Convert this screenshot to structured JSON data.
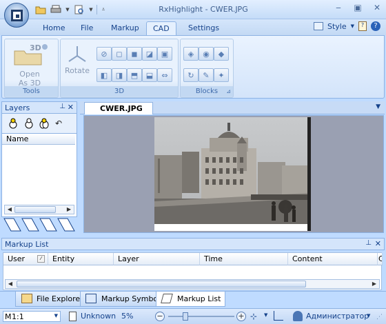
{
  "window": {
    "title": "RxHighlight - CWER.JPG",
    "controls": [
      "minimize-icon",
      "restore-icon",
      "close-icon"
    ]
  },
  "ribbon_tabs": [
    {
      "label": "Home",
      "active": false
    },
    {
      "label": "File",
      "active": false
    },
    {
      "label": "Markup",
      "active": false
    },
    {
      "label": "CAD",
      "active": true
    },
    {
      "label": "Settings",
      "active": false
    }
  ],
  "ribbon_right": {
    "style_label": "Style"
  },
  "ribbon_groups": {
    "tools": {
      "label": "Tools",
      "open_3d_label": "Open\nAs 3D",
      "open_3d_line1": "Open",
      "open_3d_line2": "As 3D"
    },
    "three_d": {
      "label": "3D",
      "rotate_label": "Rotate"
    },
    "blocks": {
      "label": "Blocks"
    }
  },
  "layers_panel": {
    "title": "Layers",
    "column": "Name"
  },
  "document": {
    "tab": "CWER.JPG"
  },
  "markup_list": {
    "title": "Markup List",
    "columns": [
      "User",
      "Entity",
      "Layer",
      "Time",
      "Content",
      "C"
    ]
  },
  "bottom_tabs": [
    {
      "label": "File Explorer",
      "active": false
    },
    {
      "label": "Markup Symbols",
      "active": false
    },
    {
      "label": "Markup List",
      "active": true
    }
  ],
  "status": {
    "scale": "1:1",
    "scale_prefix": "M",
    "file_status": "Unknown",
    "zoom": "5%",
    "user": "Администратор"
  },
  "colors": {
    "accent": "#15428b",
    "ribbon_bg": "#bfdbff",
    "canvas_bg": "#9aa0b2"
  }
}
